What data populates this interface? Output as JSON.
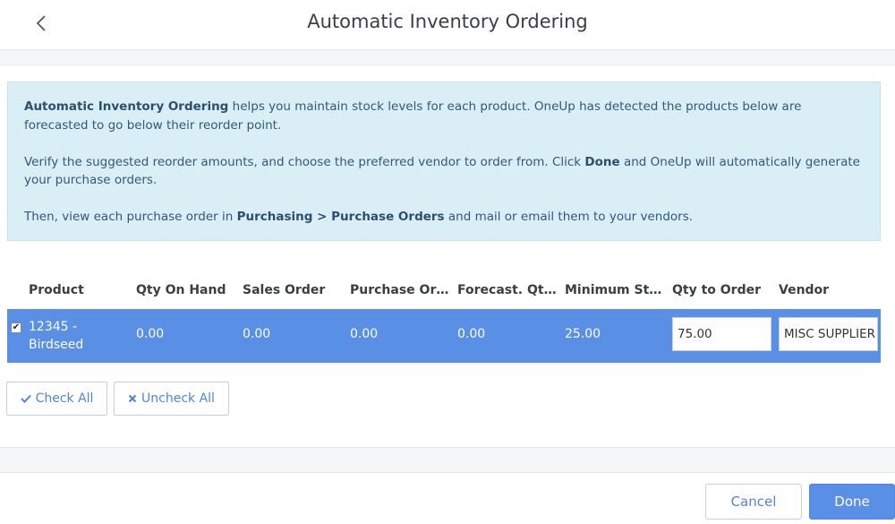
{
  "header": {
    "title": "Automatic Inventory Ordering",
    "back_icon": "chevron-left-icon"
  },
  "info": {
    "p1_bold": "Automatic Inventory Ordering",
    "p1_text": " helps you maintain stock levels for each product. OneUp has detected the products below are forecasted to go below their reorder point.",
    "p2_text_a": "Verify the suggested reorder amounts, and choose the preferred vendor to order from. Click ",
    "p2_bold": "Done",
    "p2_text_b": " and OneUp will automatically generate your purchase orders.",
    "p3_text_a": "Then, view each purchase order in ",
    "p3_bold": "Purchasing > Purchase Orders",
    "p3_text_b": " and mail or email them to your vendors."
  },
  "table": {
    "columns": [
      "Product",
      "Qty On Hand",
      "Sales Order",
      "Purchase Ord...",
      "Forecast. Qty...",
      "Minimum Sto...",
      "Qty to Order",
      "Vendor"
    ],
    "rows": [
      {
        "checked": true,
        "product_line1": "12345 -",
        "product_line2": "Birdseed",
        "qty_on_hand": "0.00",
        "sales_order": "0.00",
        "purchase_order": "0.00",
        "forecast_qty": "0.00",
        "minimum_stock": "25.00",
        "qty_to_order": "75.00",
        "vendor": "MISC SUPPLIER"
      }
    ]
  },
  "actions": {
    "check_all": "Check All",
    "uncheck_all": "Uncheck All",
    "check_icon": "checkmark-icon",
    "uncheck_icon": "x-icon"
  },
  "footer": {
    "cancel": "Cancel",
    "done": "Done"
  },
  "colors": {
    "accent": "#5a8fe6",
    "info_bg": "#daeef6",
    "info_text": "#32587a"
  }
}
